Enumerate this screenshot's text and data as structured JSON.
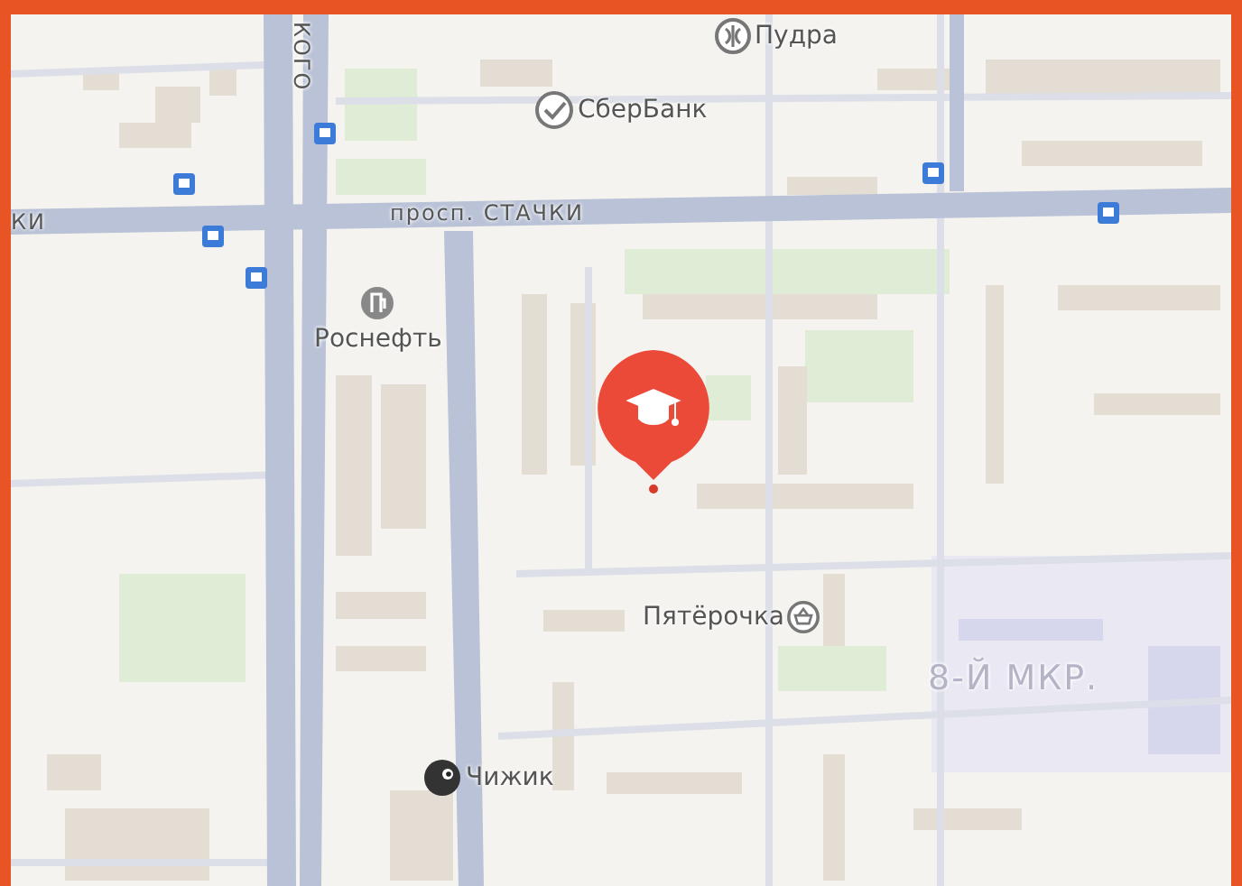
{
  "map": {
    "labels": [
      {
        "kind": "street-vertical",
        "text": "КОГО"
      },
      {
        "kind": "poi",
        "text": "Пудра"
      },
      {
        "kind": "poi",
        "text": "СберБанк"
      },
      {
        "kind": "street",
        "text": "КИ"
      },
      {
        "kind": "street",
        "text": "просп. СТАЧКИ"
      },
      {
        "kind": "poi-below",
        "text": "Роснефть"
      },
      {
        "kind": "poi-after",
        "text": "Пятёрочка"
      },
      {
        "kind": "district",
        "text": "8-Й МКР."
      },
      {
        "kind": "poi",
        "text": "Чижик"
      }
    ]
  }
}
